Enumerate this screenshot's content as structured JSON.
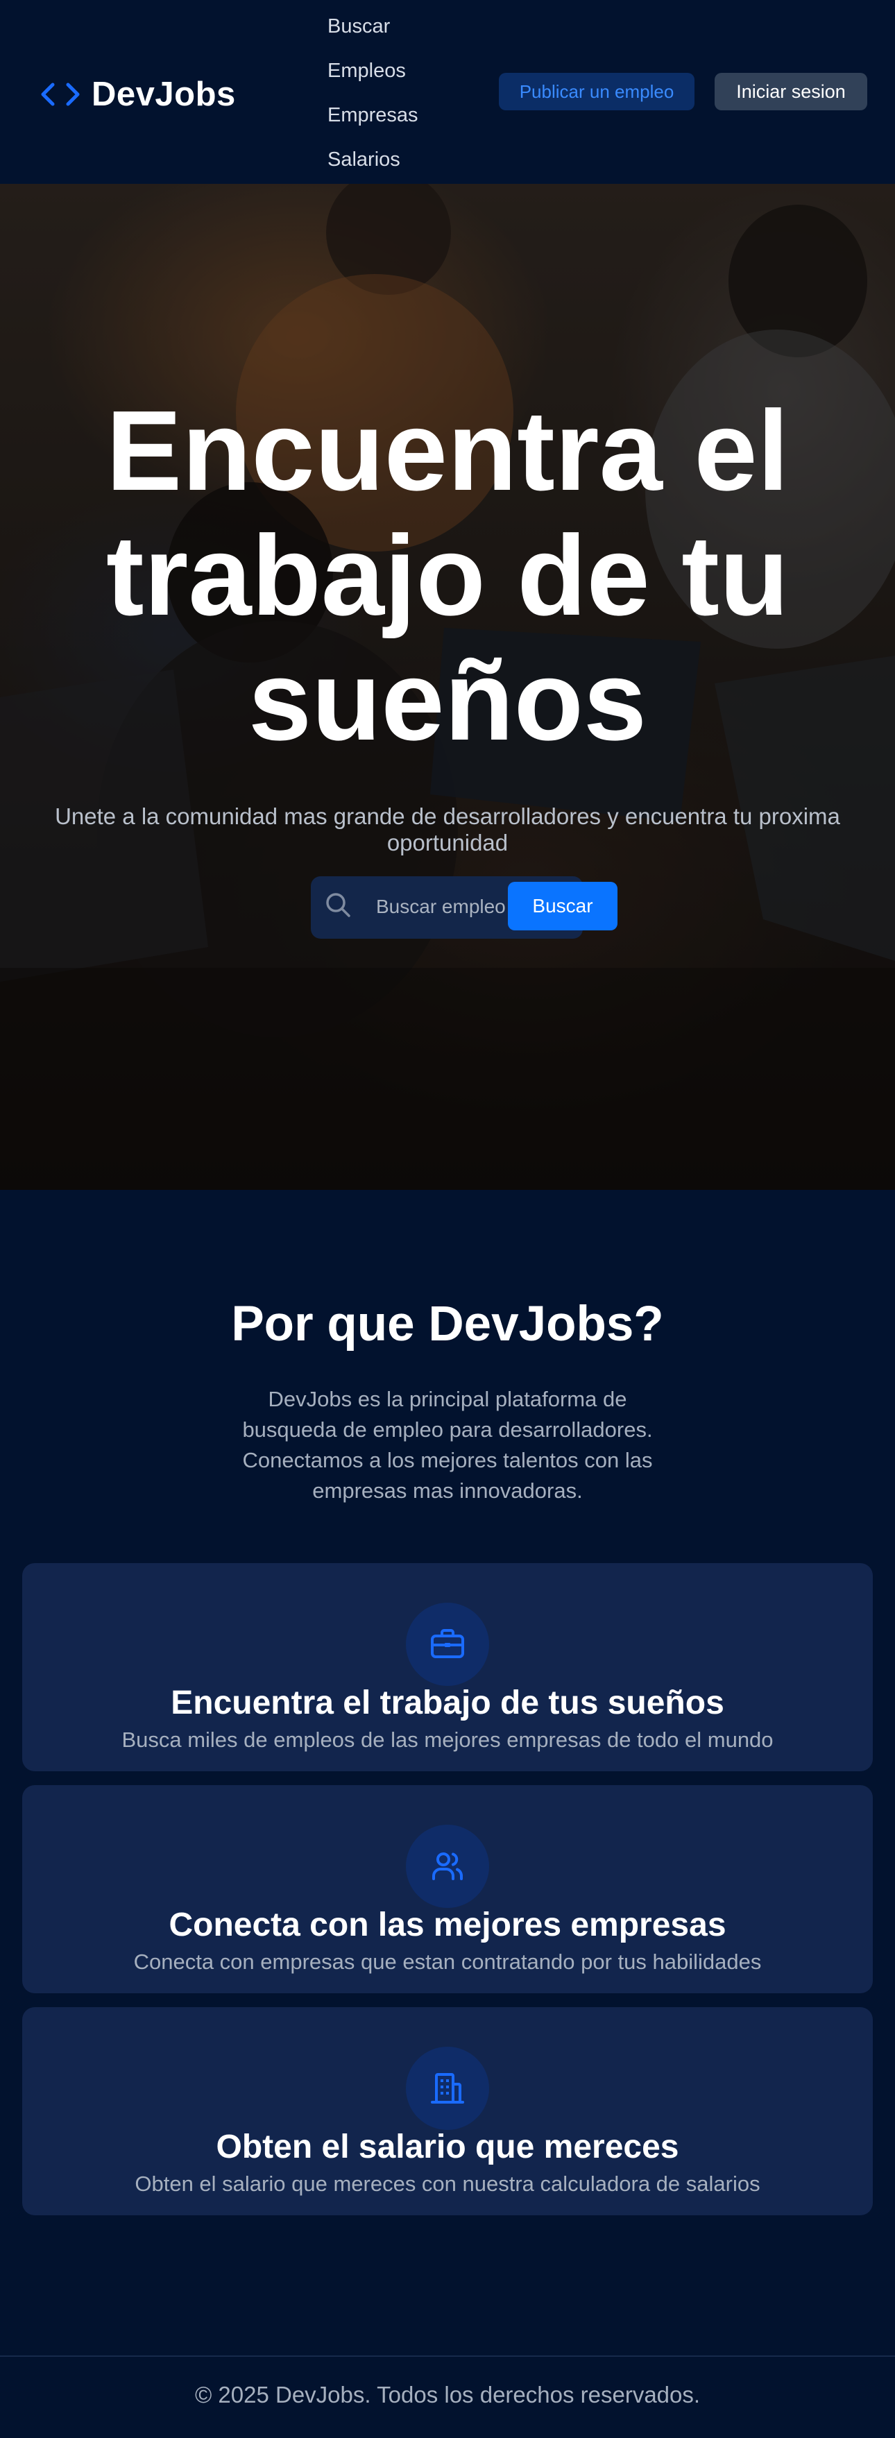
{
  "header": {
    "logo_text": "DevJobs",
    "nav": [
      "Buscar",
      "Empleos",
      "Empresas",
      "Salarios"
    ],
    "publish_label": "Publicar un empleo",
    "login_label": "Iniciar sesion"
  },
  "hero": {
    "title": "Encuentra el trabajo de tu sueños",
    "subtitle": "Unete a la comunidad mas grande de desarrolladores y encuentra tu proxima oportunidad",
    "search_placeholder": "Buscar empleo",
    "search_button": "Buscar"
  },
  "why": {
    "title": "Por que DevJobs?",
    "description": "DevJobs es la principal plataforma de busqueda de empleo para desarrolladores. Conectamos a los mejores talentos con las empresas mas innovadoras.",
    "cards": [
      {
        "icon": "briefcase-icon",
        "title": "Encuentra el trabajo de tus sueños",
        "text": "Busca miles de empleos de las mejores empresas de todo el mundo"
      },
      {
        "icon": "users-icon",
        "title": "Conecta con las mejores empresas",
        "text": "Conecta con empresas que estan contratando por tus habilidades"
      },
      {
        "icon": "building-icon",
        "title": "Obten el salario que mereces",
        "text": "Obten el salario que mereces con nuestra calculadora de salarios"
      }
    ]
  },
  "footer": {
    "text": "© 2025 DevJobs. Todos los derechos reservados."
  },
  "colors": {
    "background": "#02122e",
    "accent": "#0a74ff",
    "card": "#12254d",
    "icon_blue": "#1a6bff"
  }
}
